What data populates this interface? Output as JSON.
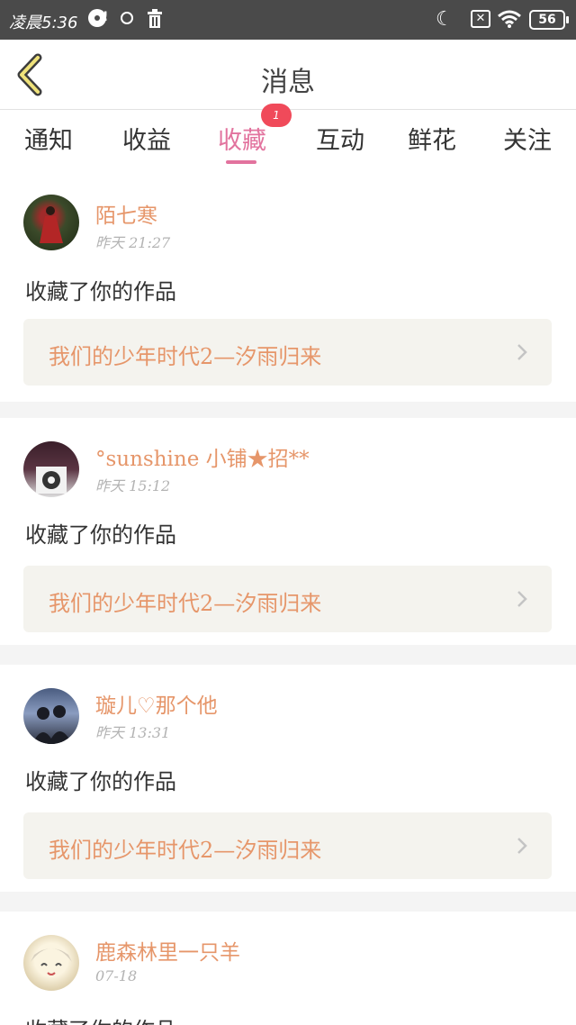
{
  "status_bar": {
    "time": "凌晨5:36",
    "battery": "56",
    "sim_icon_label": "✕",
    "icons": [
      "disc-icon",
      "alert-icon",
      "face-icon",
      "trash-icon",
      "moon-icon",
      "sim-icon",
      "wifi-icon",
      "battery-icon"
    ]
  },
  "header": {
    "title": "消息"
  },
  "tabs": [
    {
      "label": "通知"
    },
    {
      "label": "收益"
    },
    {
      "label": "收藏",
      "active": true,
      "badge": "1"
    },
    {
      "label": "互动"
    },
    {
      "label": "鲜花"
    },
    {
      "label": "关注"
    }
  ],
  "messages": [
    {
      "user": "陌七寒",
      "time": "昨天 21:27",
      "action": "收藏了你的作品",
      "work": "我们的少年时代2—汐雨归来"
    },
    {
      "user": "°sunshine 小铺★招**",
      "time": "昨天 15:12",
      "action": "收藏了你的作品",
      "work": "我们的少年时代2—汐雨归来"
    },
    {
      "user": "璇儿♡那个他",
      "time": "昨天 13:31",
      "action": "收藏了你的作品",
      "work": "我们的少年时代2—汐雨归来"
    },
    {
      "user": "鹿森林里一只羊",
      "time": "07-18",
      "action": "收藏了你的作品"
    }
  ],
  "colors": {
    "accent": "#e2739e",
    "username": "#e6966a",
    "badge": "#f04a5a",
    "work_box": "#f4f3ee"
  }
}
